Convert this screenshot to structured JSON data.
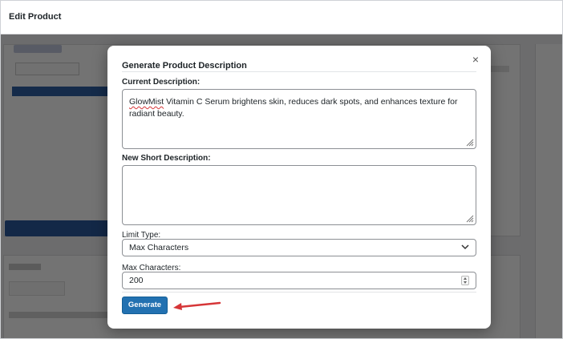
{
  "page": {
    "title": "Edit Product"
  },
  "modal": {
    "title": "Generate Product Description",
    "close_glyph": "×",
    "current_description": {
      "label": "Current Description:",
      "text_misspelled": "GlowMist",
      "text_rest": " Vitamin C Serum brightens skin, reduces dark spots, and enhances texture for radiant beauty."
    },
    "new_short_description": {
      "label": "New Short Description:",
      "value": ""
    },
    "limit_type": {
      "label": "Limit Type:",
      "selected": "Max Characters"
    },
    "max_characters": {
      "label": "Max Characters:",
      "value": "200"
    },
    "generate_label": "Generate"
  },
  "colors": {
    "accent": "#2271b1",
    "annotation_arrow": "#d63638"
  }
}
